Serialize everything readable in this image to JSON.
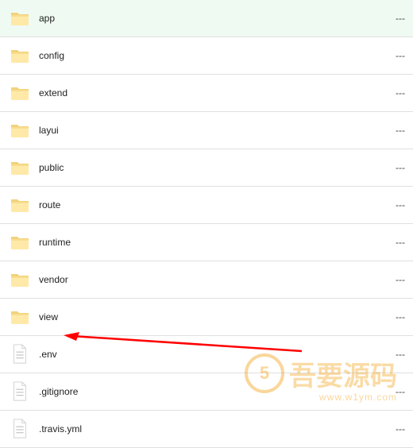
{
  "files": [
    {
      "name": "app",
      "type": "folder",
      "size": "---"
    },
    {
      "name": "config",
      "type": "folder",
      "size": "---"
    },
    {
      "name": "extend",
      "type": "folder",
      "size": "---"
    },
    {
      "name": "layui",
      "type": "folder",
      "size": "---"
    },
    {
      "name": "public",
      "type": "folder",
      "size": "---"
    },
    {
      "name": "route",
      "type": "folder",
      "size": "---"
    },
    {
      "name": "runtime",
      "type": "folder",
      "size": "---"
    },
    {
      "name": "vendor",
      "type": "folder",
      "size": "---"
    },
    {
      "name": "view",
      "type": "folder",
      "size": "---"
    },
    {
      "name": ".env",
      "type": "file",
      "size": "---"
    },
    {
      "name": ".gitignore",
      "type": "file",
      "size": "---"
    },
    {
      "name": ".travis.yml",
      "type": "file",
      "size": "---"
    }
  ],
  "watermark": {
    "text": "吾要源码",
    "url": "www.w1ym.com",
    "logo_letter": "5"
  }
}
